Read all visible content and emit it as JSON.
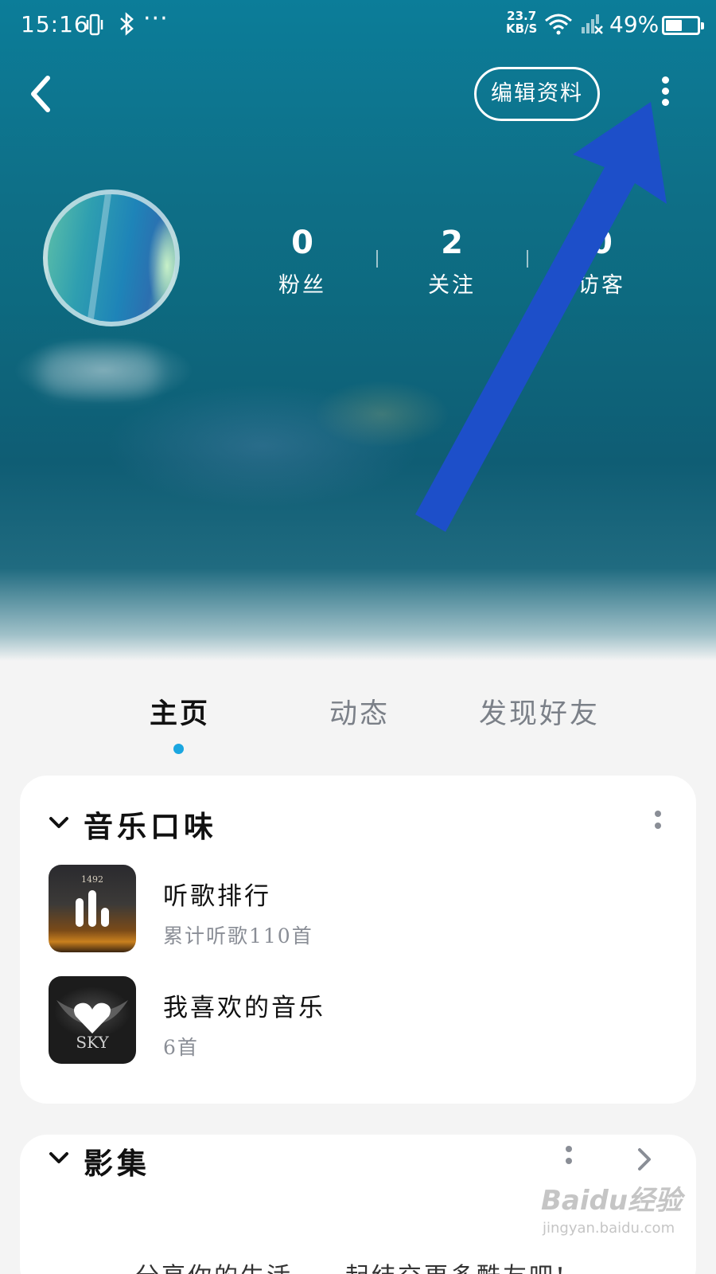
{
  "status_bar": {
    "time": "15:16",
    "more": "···",
    "net_speed_value": "23.7",
    "net_speed_unit": "KB/S",
    "battery": "49%"
  },
  "header": {
    "edit_label": "编辑资料"
  },
  "profile": {
    "stats": [
      {
        "value": "0",
        "label": "粉丝"
      },
      {
        "value": "2",
        "label": "关注"
      },
      {
        "value": "0",
        "label": "访客"
      }
    ]
  },
  "tabs": [
    {
      "label": "主页",
      "active": true
    },
    {
      "label": "动态",
      "active": false
    },
    {
      "label": "发现好友",
      "active": false
    }
  ],
  "music_card": {
    "title": "音乐口味",
    "items": [
      {
        "title": "听歌排行",
        "subtitle": "累计听歌110首",
        "thumb_text": "1492"
      },
      {
        "title": "我喜欢的音乐",
        "subtitle": "6首",
        "thumb_text": "SKY"
      }
    ]
  },
  "album_card": {
    "title": "影集",
    "text": "分享你的生活，一起结交更多酷友吧!"
  },
  "watermark": {
    "main": "Baidu经验",
    "sub": "jingyan.baidu.com"
  },
  "colors": {
    "accent_dot": "#1aa6e0",
    "annotation_arrow": "#1d4fc9"
  }
}
